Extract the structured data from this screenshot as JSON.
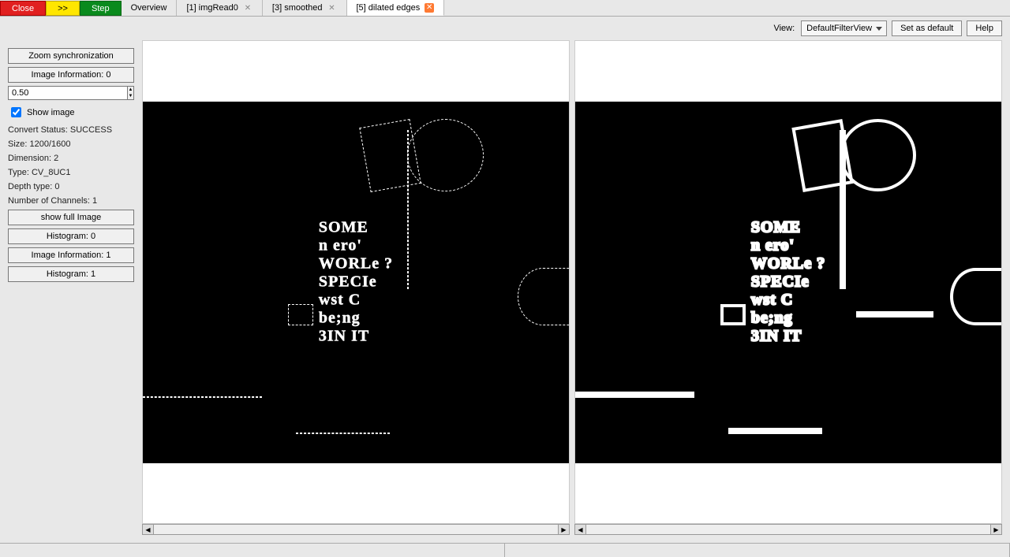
{
  "toolbar": {
    "close_label": "Close",
    "fast_forward_label": ">>",
    "step_label": "Step"
  },
  "tabs": [
    {
      "label": "Overview",
      "closable": false
    },
    {
      "label": "[1] imgRead0",
      "closable": true
    },
    {
      "label": "[3] smoothed",
      "closable": true
    },
    {
      "label": "[5] dilated edges",
      "closable": true,
      "active": true
    }
  ],
  "view_bar": {
    "label": "View:",
    "selected": "DefaultFilterView",
    "set_default_label": "Set as default",
    "help_label": "Help"
  },
  "sidebar": {
    "zoom_sync_label": "Zoom synchronization",
    "image_info_0_label": "Image Information: 0",
    "zoom_value": "0.50",
    "show_image_label": "Show image",
    "show_image_checked": true,
    "info": {
      "convert_status": "Convert Status: SUCCESS",
      "size": "Size: 1200/1600",
      "dimension": "Dimension: 2",
      "type": "Type: CV_8UC1",
      "depth_type": "Depth type: 0",
      "channels": "Number of Channels: 1"
    },
    "show_full_image_label": "show full Image",
    "histogram_0_label": "Histogram: 0",
    "image_info_1_label": "Image Information: 1",
    "histogram_1_label": "Histogram: 1"
  },
  "image_text": "SOME\nn ero'\nWORLe ?\nSPECIe\nwst C\nbe;ng\n3IN IT"
}
